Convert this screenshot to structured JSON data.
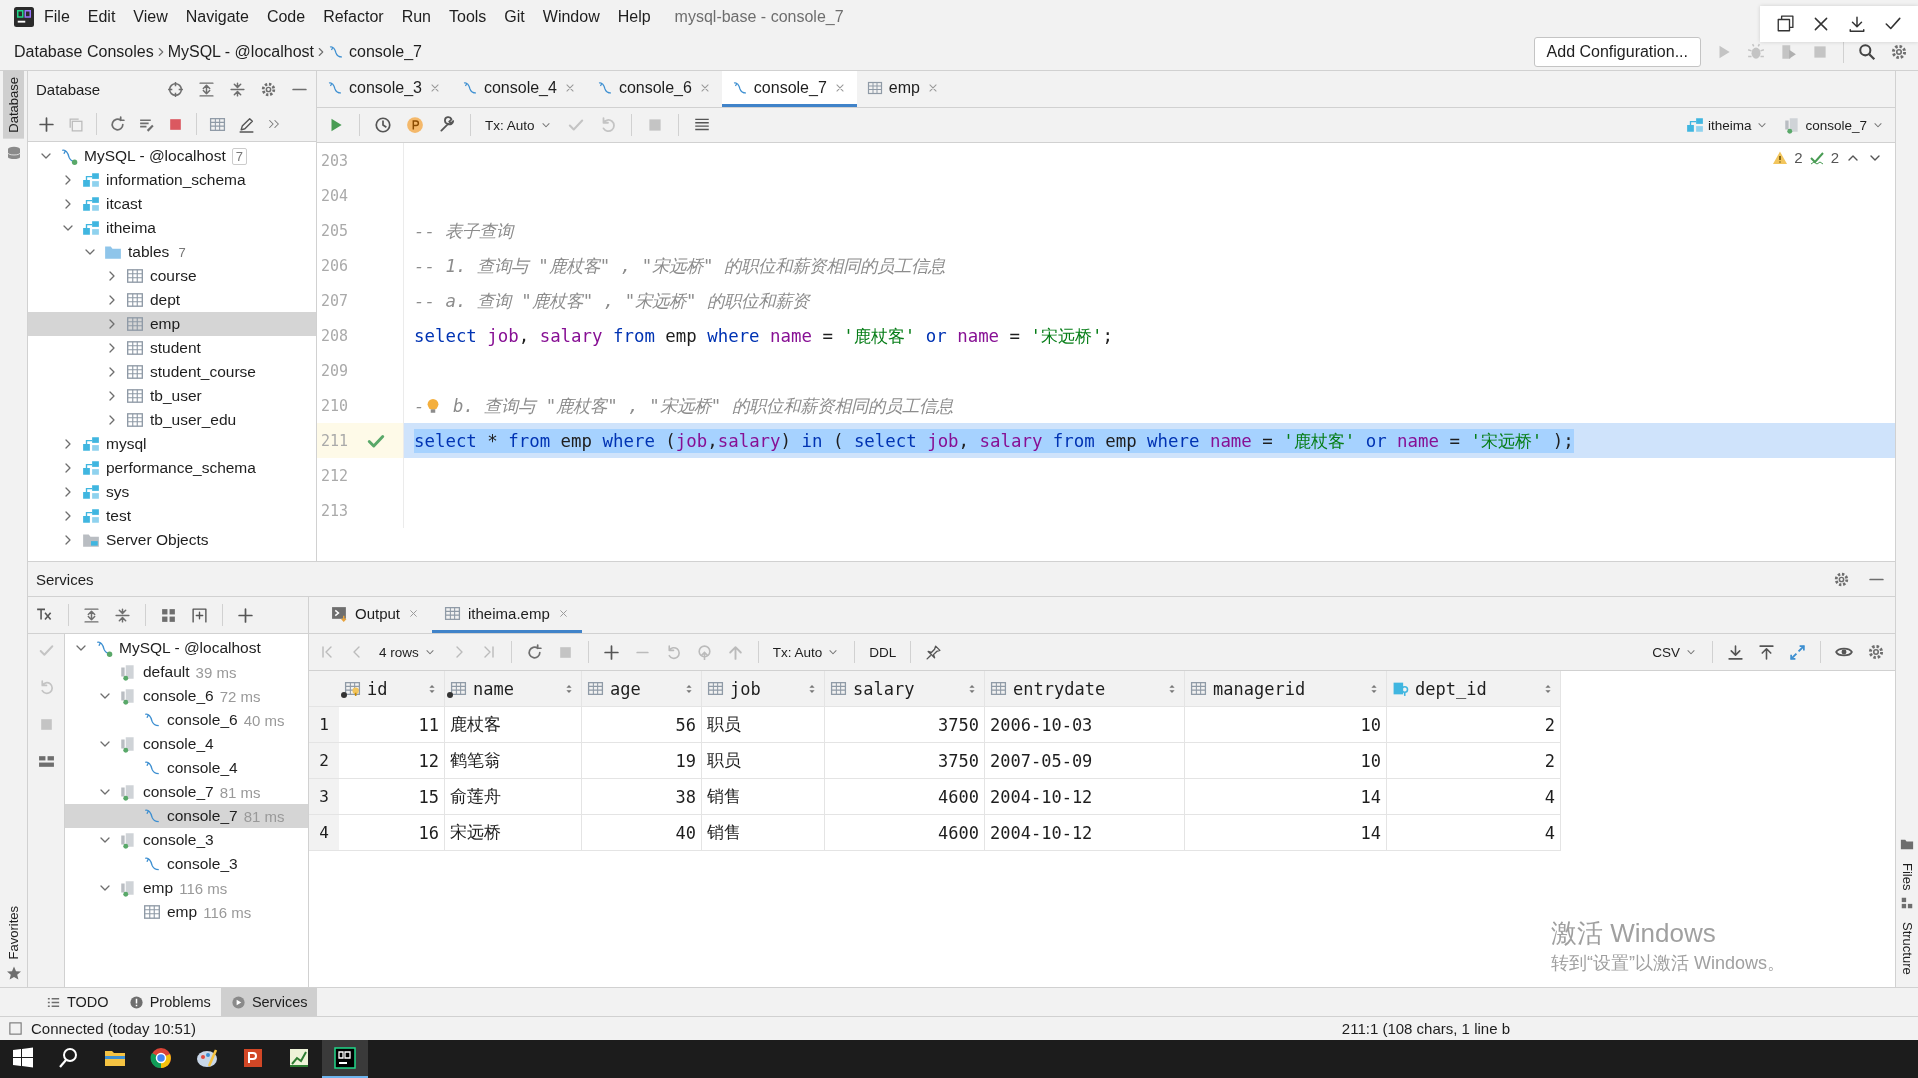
{
  "menu_bar": {
    "items": [
      "File",
      "Edit",
      "View",
      "Navigate",
      "Code",
      "Refactor",
      "Run",
      "Tools",
      "Git",
      "Window",
      "Help"
    ],
    "title": "mysql-base - console_7"
  },
  "nav_bar": {
    "breadcrumbs": [
      {
        "label": "Database Consoles",
        "kind": "text"
      },
      {
        "label": "MySQL - @localhost",
        "kind": "text"
      },
      {
        "label": "console_7",
        "kind": "console"
      }
    ],
    "run_config": "Add Configuration..."
  },
  "side_stripes": {
    "left_top": "Database",
    "left_bottom": "Favorites",
    "right_top": "Files",
    "right_bottom": "Structure"
  },
  "database_panel": {
    "title": "Database",
    "tree": [
      {
        "label": "MySQL - @localhost",
        "count": "7",
        "kind": "connection",
        "expanded": true,
        "selected": false,
        "children": [
          {
            "label": "information_schema",
            "kind": "schema",
            "expanded": false,
            "selected": false
          },
          {
            "label": "itcast",
            "kind": "schema",
            "expanded": false,
            "selected": false
          },
          {
            "label": "itheima",
            "kind": "schema",
            "expanded": true,
            "selected": false,
            "children": [
              {
                "label": "tables",
                "count": "7",
                "kind": "folder",
                "expanded": true,
                "selected": false,
                "children": [
                  {
                    "label": "course",
                    "kind": "table",
                    "expanded": false,
                    "selected": false
                  },
                  {
                    "label": "dept",
                    "kind": "table",
                    "expanded": false,
                    "selected": false
                  },
                  {
                    "label": "emp",
                    "kind": "table",
                    "expanded": false,
                    "selected": true
                  },
                  {
                    "label": "student",
                    "kind": "table",
                    "expanded": false,
                    "selected": false
                  },
                  {
                    "label": "student_course",
                    "kind": "table",
                    "expanded": false,
                    "selected": false
                  },
                  {
                    "label": "tb_user",
                    "kind": "table",
                    "expanded": false,
                    "selected": false
                  },
                  {
                    "label": "tb_user_edu",
                    "kind": "table",
                    "expanded": false,
                    "selected": false
                  }
                ]
              }
            ]
          },
          {
            "label": "mysql",
            "kind": "schema",
            "expanded": false,
            "selected": false
          },
          {
            "label": "performance_schema",
            "kind": "schema",
            "expanded": false,
            "selected": false
          },
          {
            "label": "sys",
            "kind": "schema",
            "expanded": false,
            "selected": false
          },
          {
            "label": "test",
            "kind": "schema",
            "expanded": false,
            "selected": false
          },
          {
            "label": "Server Objects",
            "kind": "server",
            "expanded": false,
            "selected": false
          }
        ]
      }
    ]
  },
  "editor": {
    "tabs": [
      {
        "label": "console_3",
        "kind": "console",
        "selected": false
      },
      {
        "label": "console_4",
        "kind": "console",
        "selected": false
      },
      {
        "label": "console_6",
        "kind": "console",
        "selected": false
      },
      {
        "label": "console_7",
        "kind": "console",
        "selected": true
      },
      {
        "label": "emp",
        "kind": "table",
        "selected": false
      }
    ],
    "tx_mode": "Tx: Auto",
    "schema": "itheima",
    "session": "console_7",
    "warnings": "2",
    "checks": "2",
    "lines": [
      {
        "num": "203",
        "highlighted": false,
        "executed": false
      },
      {
        "num": "204",
        "highlighted": false,
        "executed": false
      },
      {
        "num": "205",
        "highlighted": false,
        "executed": false,
        "tokens": [
          {
            "kind": "comment",
            "text": "-- 表子查询"
          }
        ]
      },
      {
        "num": "206",
        "highlighted": false,
        "executed": false,
        "tokens": [
          {
            "kind": "comment",
            "text": "-- 1. 查询与 \"鹿杖客\" , \"宋远桥\" 的职位和薪资相同的员工信息"
          }
        ]
      },
      {
        "num": "207",
        "highlighted": false,
        "executed": false,
        "tokens": [
          {
            "kind": "comment",
            "text": "-- a. 查询 \"鹿杖客\" , \"宋远桥\" 的职位和薪资"
          }
        ]
      },
      {
        "num": "208",
        "highlighted": false,
        "executed": false,
        "tokens": [
          {
            "kind": "keyword",
            "text": "select "
          },
          {
            "kind": "column",
            "text": "job"
          },
          {
            "kind": "plain",
            "text": ", "
          },
          {
            "kind": "column",
            "text": "salary "
          },
          {
            "kind": "keyword",
            "text": "from"
          },
          {
            "kind": "plain",
            "text": " emp "
          },
          {
            "kind": "keyword",
            "text": "where "
          },
          {
            "kind": "column",
            "text": "name"
          },
          {
            "kind": "plain",
            "text": " = "
          },
          {
            "kind": "string",
            "text": "'鹿杖客' "
          },
          {
            "kind": "keyword",
            "text": "or "
          },
          {
            "kind": "column",
            "text": "name"
          },
          {
            "kind": "plain",
            "text": " = "
          },
          {
            "kind": "string",
            "text": "'宋远桥'"
          },
          {
            "kind": "plain",
            "text": ";"
          }
        ]
      },
      {
        "num": "209",
        "highlighted": false,
        "executed": false
      },
      {
        "num": "210",
        "highlighted": false,
        "executed": false,
        "tokens": [
          {
            "kind": "comment",
            "text": "-"
          },
          {
            "kind": "bulb"
          },
          {
            "kind": "comment",
            "text": " b. 查询与 \"鹿杖客\" , \"宋远桥\" 的职位和薪资相同的员工信息"
          }
        ]
      },
      {
        "num": "211",
        "highlighted": true,
        "executed": true,
        "tokens": [
          {
            "kind": "keyword",
            "text": "select"
          },
          {
            "kind": "plain",
            "text": " * "
          },
          {
            "kind": "keyword",
            "text": "from"
          },
          {
            "kind": "plain",
            "text": " emp "
          },
          {
            "kind": "keyword",
            "text": "where"
          },
          {
            "kind": "plain",
            "text": " ("
          },
          {
            "kind": "column",
            "text": "job"
          },
          {
            "kind": "plain",
            "text": ","
          },
          {
            "kind": "column",
            "text": "salary"
          },
          {
            "kind": "plain",
            "text": ") "
          },
          {
            "kind": "keyword",
            "text": "in"
          },
          {
            "kind": "plain",
            "text": " ( "
          },
          {
            "kind": "keyword",
            "text": "select "
          },
          {
            "kind": "column",
            "text": "job"
          },
          {
            "kind": "plain",
            "text": ", "
          },
          {
            "kind": "column",
            "text": "salary "
          },
          {
            "kind": "keyword",
            "text": "from"
          },
          {
            "kind": "plain",
            "text": " emp "
          },
          {
            "kind": "keyword",
            "text": "where "
          },
          {
            "kind": "column",
            "text": "name"
          },
          {
            "kind": "plain",
            "text": " = "
          },
          {
            "kind": "string",
            "text": "'鹿杖客' "
          },
          {
            "kind": "keyword",
            "text": "or "
          },
          {
            "kind": "column",
            "text": "name"
          },
          {
            "kind": "plain",
            "text": " = "
          },
          {
            "kind": "string",
            "text": "'宋远桥'"
          },
          {
            "kind": "plain",
            "text": " );"
          }
        ]
      },
      {
        "num": "212",
        "highlighted": false,
        "executed": false
      },
      {
        "num": "213",
        "highlighted": false,
        "executed": false
      }
    ]
  },
  "services": {
    "title": "Services",
    "tree": [
      {
        "label": "MySQL - @localhost",
        "kind": "connection",
        "expanded": true,
        "selected": false,
        "children": [
          {
            "label": "default",
            "time": "39 ms",
            "kind": "session",
            "selected": false
          },
          {
            "label": "console_6",
            "time": "72 ms",
            "kind": "session",
            "expanded": true,
            "selected": false,
            "children": [
              {
                "label": "console_6",
                "time": "40 ms",
                "kind": "console",
                "selected": false
              }
            ]
          },
          {
            "label": "console_4",
            "kind": "session",
            "expanded": true,
            "selected": false,
            "children": [
              {
                "label": "console_4",
                "kind": "console",
                "selected": false
              }
            ]
          },
          {
            "label": "console_7",
            "time": "81 ms",
            "kind": "session",
            "expanded": true,
            "selected": false,
            "children": [
              {
                "label": "console_7",
                "time": "81 ms",
                "kind": "console",
                "selected": true
              }
            ]
          },
          {
            "label": "console_3",
            "kind": "session",
            "expanded": true,
            "selected": false,
            "children": [
              {
                "label": "console_3",
                "kind": "console",
                "selected": false
              }
            ]
          },
          {
            "label": "emp",
            "time": "116 ms",
            "kind": "session",
            "expanded": true,
            "selected": false,
            "children": [
              {
                "label": "emp",
                "time": "116 ms",
                "kind": "table",
                "selected": false
              }
            ]
          }
        ]
      }
    ],
    "result_tabs": [
      {
        "label": "Output",
        "kind": "output",
        "selected": false
      },
      {
        "label": "itheima.emp",
        "kind": "table",
        "selected": true
      }
    ],
    "rows_label": "4 rows",
    "tx_mode": "Tx: Auto",
    "ddl": "DDL",
    "export_format": "CSV",
    "table": {
      "columns": [
        {
          "name": "id",
          "kind": "key",
          "required": true
        },
        {
          "name": "name",
          "kind": "column",
          "required": true
        },
        {
          "name": "age",
          "kind": "column",
          "required": false
        },
        {
          "name": "job",
          "kind": "column",
          "required": false
        },
        {
          "name": "salary",
          "kind": "column",
          "required": false
        },
        {
          "name": "entrydate",
          "kind": "column",
          "required": false
        },
        {
          "name": "managerid",
          "kind": "column",
          "required": false
        },
        {
          "name": "dept_id",
          "kind": "foreign_key",
          "required": false
        }
      ],
      "rows": [
        {
          "num": "1",
          "cells": [
            "11",
            "鹿杖客",
            "56",
            "职员",
            "3750",
            "2006-10-03",
            "10",
            "2"
          ]
        },
        {
          "num": "2",
          "cells": [
            "12",
            "鹤笔翁",
            "19",
            "职员",
            "3750",
            "2007-05-09",
            "10",
            "2"
          ]
        },
        {
          "num": "3",
          "cells": [
            "15",
            "俞莲舟",
            "38",
            "销售",
            "4600",
            "2004-10-12",
            "14",
            "4"
          ]
        },
        {
          "num": "4",
          "cells": [
            "16",
            "宋远桥",
            "40",
            "销售",
            "4600",
            "2004-10-12",
            "14",
            "4"
          ]
        }
      ]
    }
  },
  "os_notice": {
    "title": "激活 Windows",
    "subtitle": "转到“设置”以激活 Windows。"
  },
  "tool_window_tabs": [
    {
      "label": "TODO",
      "kind": "todo",
      "selected": false
    },
    {
      "label": "Problems",
      "kind": "problems",
      "selected": false
    },
    {
      "label": "Services",
      "kind": "services",
      "selected": true
    }
  ],
  "status_bar": {
    "message": "Connected (today 10:51)",
    "position": "211:1 (108 chars, 1 line b"
  },
  "taskbar": {
    "apps": [
      {
        "kind": "start",
        "selected": false
      },
      {
        "kind": "search",
        "selected": false
      },
      {
        "kind": "files",
        "selected": false
      },
      {
        "kind": "browser",
        "selected": false
      },
      {
        "kind": "paint",
        "selected": false
      },
      {
        "kind": "slides",
        "selected": false
      },
      {
        "kind": "chart",
        "selected": false
      },
      {
        "kind": "ide",
        "selected": true
      }
    ]
  }
}
